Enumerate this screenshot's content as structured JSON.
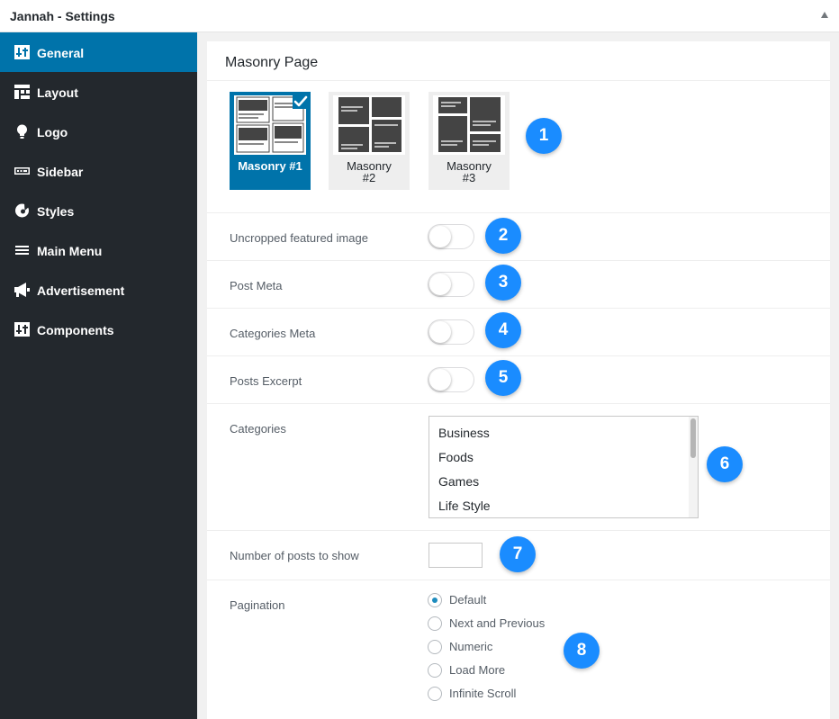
{
  "window": {
    "title": "Jannah - Settings"
  },
  "sidebar": {
    "items": [
      {
        "label": "General",
        "icon": "general-icon",
        "active": true
      },
      {
        "label": "Layout",
        "icon": "layout-icon"
      },
      {
        "label": "Logo",
        "icon": "lightbulb-icon"
      },
      {
        "label": "Sidebar",
        "icon": "sidebar-icon"
      },
      {
        "label": "Styles",
        "icon": "palette-icon"
      },
      {
        "label": "Main Menu",
        "icon": "menu-icon"
      },
      {
        "label": "Advertisement",
        "icon": "megaphone-icon"
      },
      {
        "label": "Components",
        "icon": "components-icon"
      }
    ]
  },
  "main": {
    "section_title": "Masonry Page",
    "layouts": [
      {
        "label": "Masonry #1",
        "selected": true
      },
      {
        "label": "Masonry\n#2",
        "selected": false
      },
      {
        "label": "Masonry\n#3",
        "selected": false
      }
    ],
    "toggles": [
      {
        "label": "Uncropped featured image",
        "on": false
      },
      {
        "label": "Post Meta",
        "on": false
      },
      {
        "label": "Categories Meta",
        "on": false
      },
      {
        "label": "Posts Excerpt",
        "on": false
      }
    ],
    "categories": {
      "label": "Categories",
      "options": [
        "Business",
        "Foods",
        "Games",
        "Life Style"
      ]
    },
    "posts_count": {
      "label": "Number of posts to show",
      "value": ""
    },
    "pagination": {
      "label": "Pagination",
      "options": [
        "Default",
        "Next and Previous",
        "Numeric",
        "Load More",
        "Infinite Scroll"
      ],
      "selected": "Default"
    }
  },
  "badges": [
    "1",
    "2",
    "3",
    "4",
    "5",
    "6",
    "7",
    "8"
  ],
  "colors": {
    "accent": "#0073aa",
    "sidebar_bg": "#23282d",
    "badge": "#1a8cff"
  }
}
